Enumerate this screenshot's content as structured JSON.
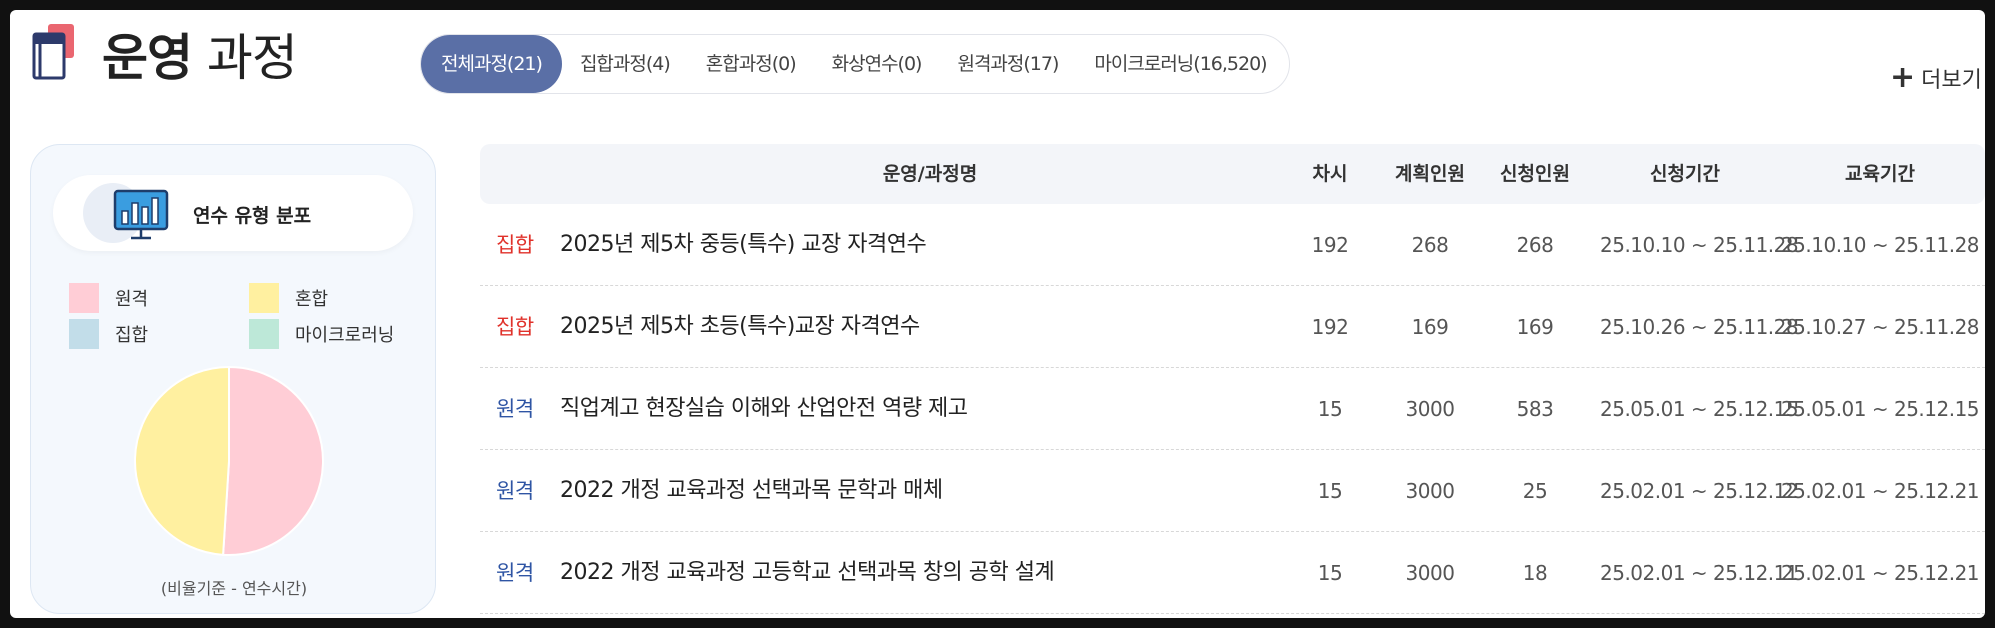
{
  "header": {
    "title_bold": "운영",
    "title_light": "과정",
    "more_label": "더보기"
  },
  "tabs": [
    {
      "label": "전체과정(21)",
      "active": true
    },
    {
      "label": "집합과정(4)",
      "active": false
    },
    {
      "label": "혼합과정(0)",
      "active": false
    },
    {
      "label": "화상연수(0)",
      "active": false
    },
    {
      "label": "원격과정(17)",
      "active": false
    },
    {
      "label": "마이크로러닝(16,520)",
      "active": false
    }
  ],
  "distribution": {
    "title": "연수 유형 분포",
    "legend": [
      {
        "label": "원격",
        "color": "#ffcdd6"
      },
      {
        "label": "혼합",
        "color": "#fff0a0"
      },
      {
        "label": "집합",
        "color": "#c2dde9"
      },
      {
        "label": "마이크로러닝",
        "color": "#bde8d8"
      }
    ],
    "note": "(비율기준 - 연수시간)"
  },
  "chart_data": {
    "type": "pie",
    "categories": [
      "원격",
      "혼합"
    ],
    "values": [
      51,
      49
    ],
    "colors": [
      "#ffcdd6",
      "#fff0a0"
    ],
    "title": ""
  },
  "table": {
    "headers": {
      "name": "운영/과정명",
      "round": "차시",
      "plan": "계획인원",
      "apply": "신청인원",
      "apply_period": "신청기간",
      "edu_period": "교육기간"
    },
    "rows": [
      {
        "type": "집합",
        "type_color": "#e0322b",
        "name": "2025년 제5차 중등(특수) 교장 자격연수",
        "round": "192",
        "plan": "268",
        "apply": "268",
        "apply_period": "25.10.10 ~ 25.11.28",
        "edu_period": "25.10.10 ~ 25.11.28"
      },
      {
        "type": "집합",
        "type_color": "#e0322b",
        "name": "2025년 제5차 초등(특수)교장 자격연수",
        "round": "192",
        "plan": "169",
        "apply": "169",
        "apply_period": "25.10.26 ~ 25.11.28",
        "edu_period": "25.10.27 ~ 25.11.28"
      },
      {
        "type": "원격",
        "type_color": "#2f55a4",
        "name": "직업계고 현장실습 이해와 산업안전 역량 제고",
        "round": "15",
        "plan": "3000",
        "apply": "583",
        "apply_period": "25.05.01 ~ 25.12.15",
        "edu_period": "25.05.01 ~ 25.12.15"
      },
      {
        "type": "원격",
        "type_color": "#2f55a4",
        "name": "2022 개정 교육과정 선택과목 문학과 매체",
        "round": "15",
        "plan": "3000",
        "apply": "25",
        "apply_period": "25.02.01 ~ 25.12.12",
        "edu_period": "25.02.01 ~ 25.12.21"
      },
      {
        "type": "원격",
        "type_color": "#2f55a4",
        "name": "2022 개정 교육과정 고등학교 선택과목 창의 공학 설계",
        "round": "15",
        "plan": "3000",
        "apply": "18",
        "apply_period": "25.02.01 ~ 25.12.11",
        "edu_period": "25.02.01 ~ 25.12.21"
      }
    ]
  }
}
